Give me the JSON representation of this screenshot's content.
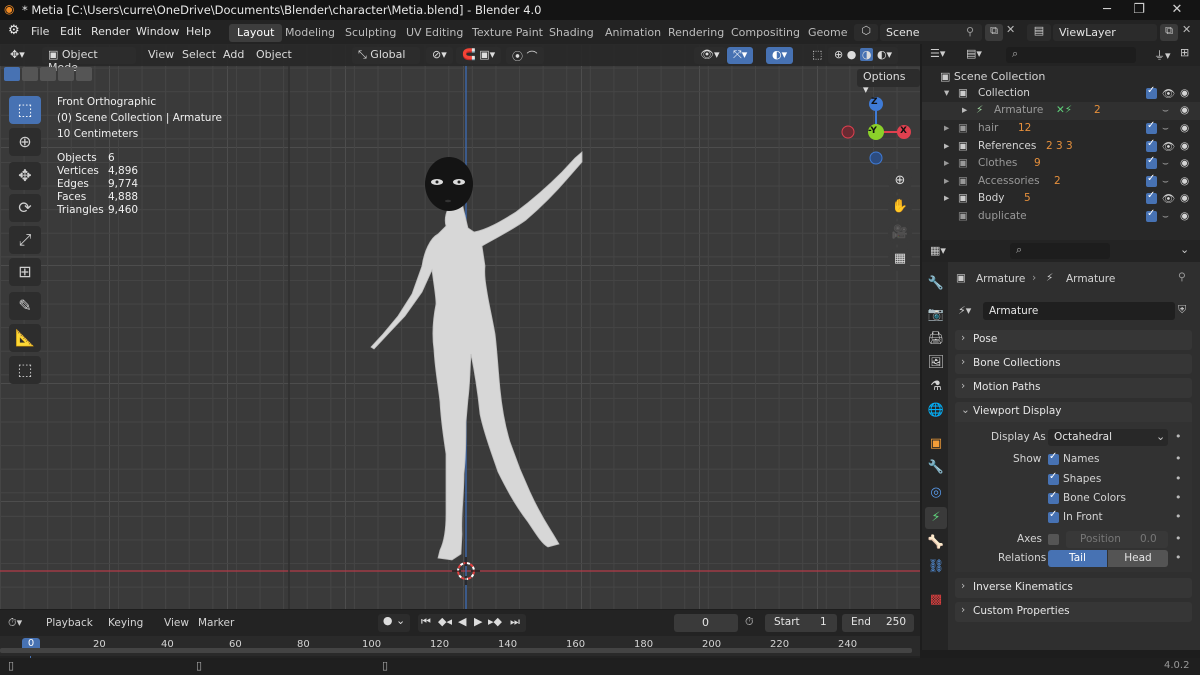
{
  "window": {
    "title": "* Metia [C:\\Users\\curre\\OneDrive\\Documents\\Blender\\character\\Metia.blend] - Blender 4.0",
    "minimize": "─",
    "maximize": "❐",
    "close": "✕"
  },
  "menus": [
    "File",
    "Edit",
    "Render",
    "Window",
    "Help"
  ],
  "workspaces": [
    "Layout",
    "Modeling",
    "Sculpting",
    "UV Editing",
    "Texture Paint",
    "Shading",
    "Animation",
    "Rendering",
    "Compositing",
    "Geomet"
  ],
  "active_workspace": "Layout",
  "scene": {
    "label": "Scene",
    "view_layer": "ViewLayer"
  },
  "viewport_header": {
    "mode": "Object Mode",
    "menus": [
      "View",
      "Select",
      "Add",
      "Object"
    ],
    "orientation": "Global",
    "options": "Options"
  },
  "viewport_overlay": {
    "view_name": "Front Orthographic",
    "collection_line": "(0) Scene Collection | Armature",
    "scale": "10 Centimeters",
    "stats": [
      {
        "label": "Objects",
        "value": "6"
      },
      {
        "label": "Vertices",
        "value": "4,896"
      },
      {
        "label": "Edges",
        "value": "9,774"
      },
      {
        "label": "Faces",
        "value": "4,888"
      },
      {
        "label": "Triangles",
        "value": "9,460"
      }
    ]
  },
  "gizmo": {
    "z": "Z",
    "y": "-Y",
    "x": "X"
  },
  "outliner": {
    "root": "Scene Collection",
    "items": [
      {
        "name": "Collection",
        "badge": ""
      },
      {
        "name": "Armature",
        "badge": "2"
      },
      {
        "name": "hair",
        "badge": "12"
      },
      {
        "name": "References",
        "badge": "2 3 3"
      },
      {
        "name": "Clothes",
        "badge": "9"
      },
      {
        "name": "Accessories",
        "badge": "2"
      },
      {
        "name": "Body",
        "badge": "5"
      },
      {
        "name": "duplicate",
        "badge": ""
      }
    ]
  },
  "properties": {
    "breadcrumb_object": "Armature",
    "breadcrumb_data": "Armature",
    "data_name": "Armature",
    "panels": {
      "pose": "Pose",
      "bone_collections": "Bone Collections",
      "motion_paths": "Motion Paths",
      "viewport_display": "Viewport Display",
      "inverse_kinematics": "Inverse Kinematics",
      "custom_properties": "Custom Properties"
    },
    "display_as_label": "Display As",
    "display_as_value": "Octahedral",
    "show_label": "Show",
    "show_options": [
      {
        "label": "Names",
        "checked": true
      },
      {
        "label": "Shapes",
        "checked": true
      },
      {
        "label": "Bone Colors",
        "checked": true
      },
      {
        "label": "In Front",
        "checked": true
      }
    ],
    "axes_label": "Axes",
    "axes_position_label": "Position",
    "axes_position_value": "0.0",
    "relations_label": "Relations",
    "relations_tail": "Tail",
    "relations_head": "Head"
  },
  "timeline": {
    "menus": [
      "Playback",
      "Keying",
      "View",
      "Marker"
    ],
    "current_frame": "0",
    "start_label": "Start",
    "start_value": "1",
    "end_label": "End",
    "end_value": "250",
    "ticks": [
      "0",
      "20",
      "40",
      "60",
      "80",
      "100",
      "120",
      "140",
      "160",
      "180",
      "200",
      "220",
      "240"
    ]
  },
  "status": {
    "version": "4.0.2"
  },
  "colors": {
    "accent": "#4772b3",
    "x_axis": "#e0404f",
    "y_axis": "#8bd12a",
    "z_axis": "#3f7bd6",
    "header": "#232323",
    "viewport": "#3a3a3a"
  }
}
